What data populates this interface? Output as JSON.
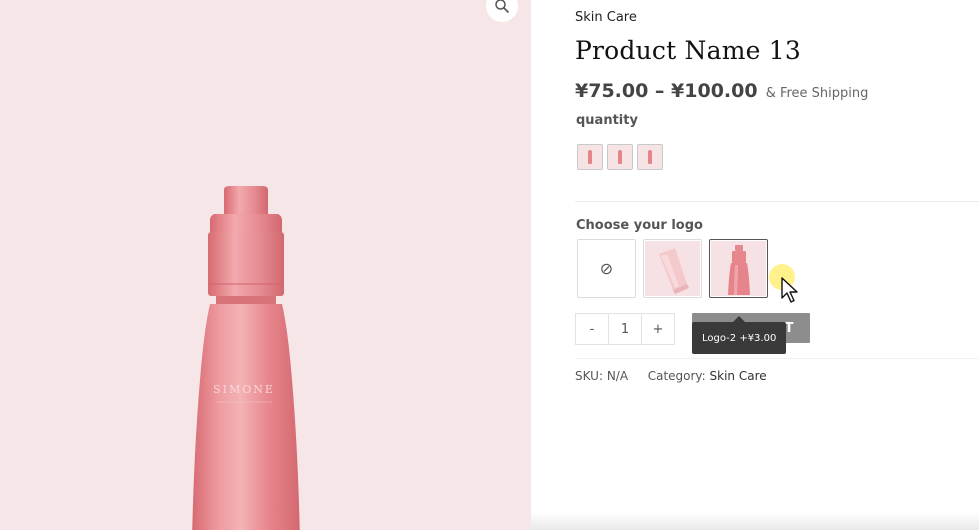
{
  "product": {
    "category_top": "Skin Care",
    "title": "Product Name 13",
    "price_range": "¥75.00 – ¥100.00",
    "shipping_note": "& Free Shipping",
    "brand_on_bottle": "SIMONE"
  },
  "attributes": {
    "quantity_label": "quantity",
    "quantity_options_count": 3,
    "logo_label": "Choose your logo",
    "logo_none_symbol": "⊘",
    "selected_logo_index": 2
  },
  "cart": {
    "minus_label": "-",
    "qty_value": "1",
    "plus_label": "+",
    "add_to_cart_visible_text": "RT",
    "tooltip": "Logo-2 +¥3.00"
  },
  "meta": {
    "sku_label": "SKU:",
    "sku_value": "N/A",
    "category_label": "Category:",
    "category_value": "Skin Care"
  },
  "icons": {
    "zoom": "search-icon",
    "cursor": "cursor-arrow-icon"
  },
  "colors": {
    "gallery_bg": "#f6e6e7",
    "bottle": "#e5848a",
    "add_to_cart_bg": "#8d8d8d",
    "tooltip_bg": "#3a3a3a"
  }
}
